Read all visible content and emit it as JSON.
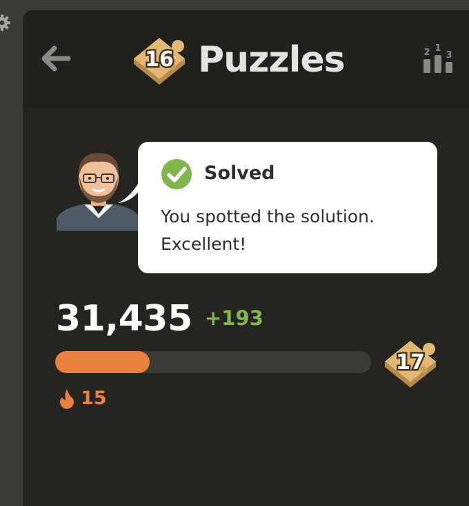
{
  "header": {
    "title": "Puzzles",
    "level_badge": "16",
    "leaderboard_digits": [
      "2",
      "1",
      "3"
    ]
  },
  "feedback": {
    "status": "Solved",
    "message": "You spotted the solution. Excellent!"
  },
  "score": {
    "rating": "31,435",
    "delta": "+193",
    "progress_fraction": 0.3,
    "next_level": "17",
    "streak": "15"
  },
  "colors": {
    "accent_orange": "#e8813f",
    "accent_green": "#81b64c",
    "badge_gold": "#e0b874"
  },
  "icons": {
    "settings": "gear-icon",
    "back": "arrow-left-icon",
    "leaderboard": "podium-icon",
    "solved": "check-circle-icon",
    "streak": "fire-icon"
  }
}
